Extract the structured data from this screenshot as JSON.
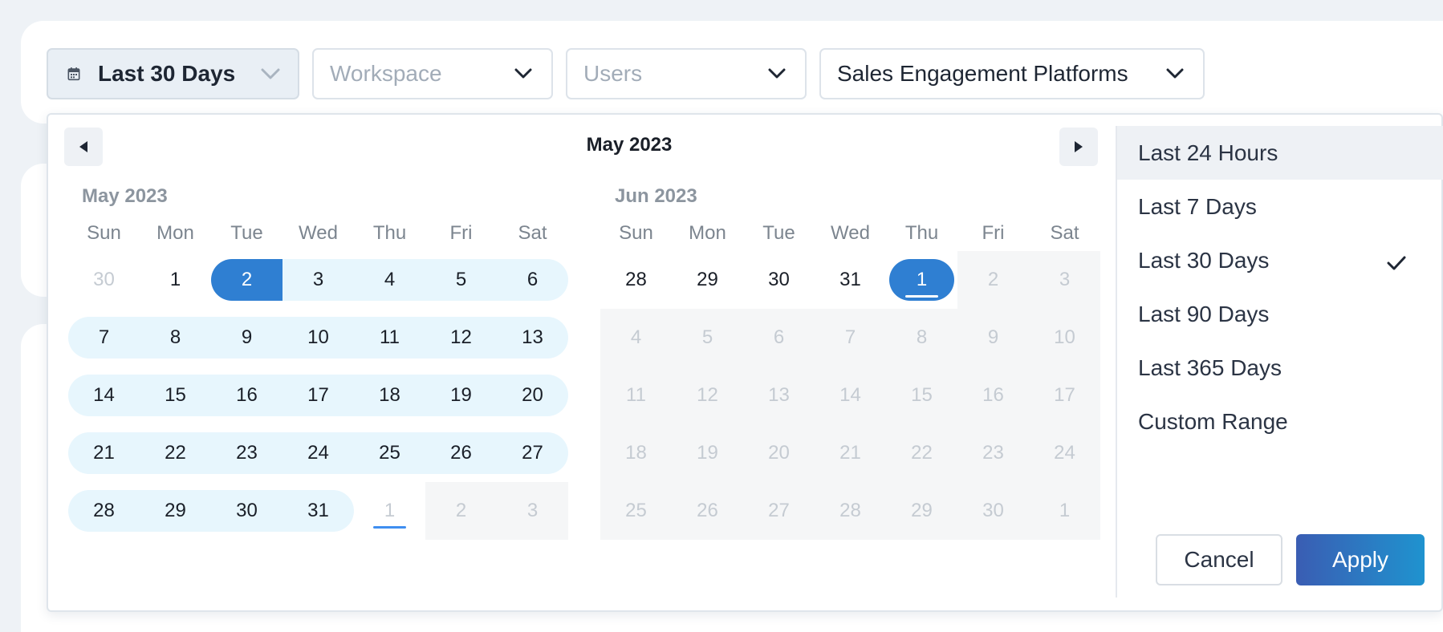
{
  "filters": {
    "date": {
      "label": "Last 30 Days"
    },
    "workspace": {
      "placeholder": "Workspace"
    },
    "users": {
      "placeholder": "Users"
    },
    "category": {
      "label": "Sales Engagement Platforms"
    }
  },
  "picker": {
    "header_title": "May 2023",
    "days_of_week": [
      "Sun",
      "Mon",
      "Tue",
      "Wed",
      "Thu",
      "Fri",
      "Sat"
    ],
    "months": [
      {
        "label": "May 2023",
        "weeks": [
          [
            {
              "d": "30",
              "state": "off"
            },
            {
              "d": "1",
              "state": "normal"
            },
            {
              "d": "2",
              "state": "selected-start"
            },
            {
              "d": "3",
              "state": "range"
            },
            {
              "d": "4",
              "state": "range"
            },
            {
              "d": "5",
              "state": "range"
            },
            {
              "d": "6",
              "state": "range-end"
            }
          ],
          [
            {
              "d": "7",
              "state": "range-start"
            },
            {
              "d": "8",
              "state": "range"
            },
            {
              "d": "9",
              "state": "range"
            },
            {
              "d": "10",
              "state": "range"
            },
            {
              "d": "11",
              "state": "range"
            },
            {
              "d": "12",
              "state": "range"
            },
            {
              "d": "13",
              "state": "range-end"
            }
          ],
          [
            {
              "d": "14",
              "state": "range-start"
            },
            {
              "d": "15",
              "state": "range"
            },
            {
              "d": "16",
              "state": "range"
            },
            {
              "d": "17",
              "state": "range"
            },
            {
              "d": "18",
              "state": "range"
            },
            {
              "d": "19",
              "state": "range"
            },
            {
              "d": "20",
              "state": "range-end"
            }
          ],
          [
            {
              "d": "21",
              "state": "range-start"
            },
            {
              "d": "22",
              "state": "range"
            },
            {
              "d": "23",
              "state": "range"
            },
            {
              "d": "24",
              "state": "range"
            },
            {
              "d": "25",
              "state": "range"
            },
            {
              "d": "26",
              "state": "range"
            },
            {
              "d": "27",
              "state": "range-end"
            }
          ],
          [
            {
              "d": "28",
              "state": "range-start"
            },
            {
              "d": "29",
              "state": "range"
            },
            {
              "d": "30",
              "state": "range"
            },
            {
              "d": "31",
              "state": "range-end"
            },
            {
              "d": "1",
              "state": "today-off"
            },
            {
              "d": "2",
              "state": "disabled"
            },
            {
              "d": "3",
              "state": "disabled"
            }
          ]
        ]
      },
      {
        "label": "Jun 2023",
        "weeks": [
          [
            {
              "d": "28",
              "state": "normal"
            },
            {
              "d": "29",
              "state": "normal"
            },
            {
              "d": "30",
              "state": "normal"
            },
            {
              "d": "31",
              "state": "normal"
            },
            {
              "d": "1",
              "state": "selected-today"
            },
            {
              "d": "2",
              "state": "disabled"
            },
            {
              "d": "3",
              "state": "disabled"
            }
          ],
          [
            {
              "d": "4",
              "state": "disabled"
            },
            {
              "d": "5",
              "state": "disabled"
            },
            {
              "d": "6",
              "state": "disabled"
            },
            {
              "d": "7",
              "state": "disabled"
            },
            {
              "d": "8",
              "state": "disabled"
            },
            {
              "d": "9",
              "state": "disabled"
            },
            {
              "d": "10",
              "state": "disabled"
            }
          ],
          [
            {
              "d": "11",
              "state": "disabled"
            },
            {
              "d": "12",
              "state": "disabled"
            },
            {
              "d": "13",
              "state": "disabled"
            },
            {
              "d": "14",
              "state": "disabled"
            },
            {
              "d": "15",
              "state": "disabled"
            },
            {
              "d": "16",
              "state": "disabled"
            },
            {
              "d": "17",
              "state": "disabled"
            }
          ],
          [
            {
              "d": "18",
              "state": "disabled"
            },
            {
              "d": "19",
              "state": "disabled"
            },
            {
              "d": "20",
              "state": "disabled"
            },
            {
              "d": "21",
              "state": "disabled"
            },
            {
              "d": "22",
              "state": "disabled"
            },
            {
              "d": "23",
              "state": "disabled"
            },
            {
              "d": "24",
              "state": "disabled"
            }
          ],
          [
            {
              "d": "25",
              "state": "disabled"
            },
            {
              "d": "26",
              "state": "disabled"
            },
            {
              "d": "27",
              "state": "disabled"
            },
            {
              "d": "28",
              "state": "disabled"
            },
            {
              "d": "29",
              "state": "disabled"
            },
            {
              "d": "30",
              "state": "disabled"
            },
            {
              "d": "1",
              "state": "disabled"
            }
          ]
        ]
      }
    ],
    "ranges": [
      {
        "label": "Last 24 Hours",
        "active": true,
        "checked": false
      },
      {
        "label": "Last 7 Days",
        "active": false,
        "checked": false
      },
      {
        "label": "Last 30 Days",
        "active": false,
        "checked": true
      },
      {
        "label": "Last 90 Days",
        "active": false,
        "checked": false
      },
      {
        "label": "Last 365 Days",
        "active": false,
        "checked": false
      },
      {
        "label": "Custom Range",
        "active": false,
        "checked": false
      }
    ],
    "cancel_label": "Cancel",
    "apply_label": "Apply"
  },
  "colors": {
    "accent": "#2f7fd2",
    "range_bg": "#e7f6fd",
    "apply_gradient_start": "#3a5db3",
    "apply_gradient_end": "#1f93cf"
  },
  "icons": {
    "date_filter": "calendar-icon",
    "dropdown": "chevron-down-icon",
    "prev": "triangle-left-icon",
    "next": "triangle-right-icon",
    "checked": "checkmark-icon"
  }
}
